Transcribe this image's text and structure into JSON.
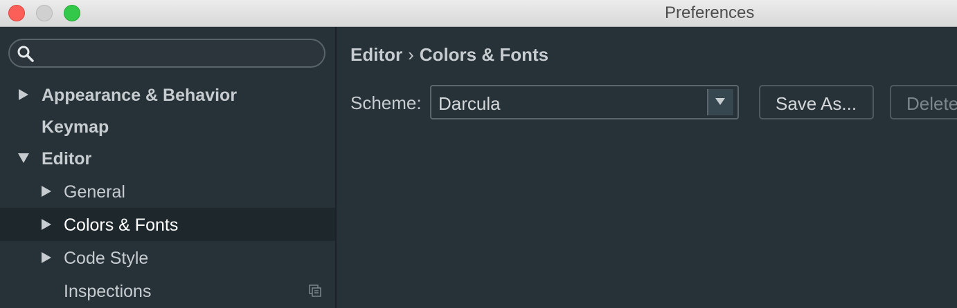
{
  "window": {
    "title": "Preferences"
  },
  "sidebar": {
    "search": {
      "value": "",
      "placeholder": ""
    },
    "items": [
      {
        "label": "Appearance & Behavior",
        "expanded": false
      },
      {
        "label": "Keymap"
      },
      {
        "label": "Editor",
        "expanded": true
      },
      {
        "label": "General",
        "expanded": false
      },
      {
        "label": "Colors & Fonts",
        "expanded": false,
        "selected": true
      },
      {
        "label": "Code Style",
        "expanded": false
      },
      {
        "label": "Inspections"
      }
    ]
  },
  "main": {
    "breadcrumb": {
      "parent": "Editor",
      "separator": "›",
      "current": "Colors & Fonts"
    },
    "scheme": {
      "label": "Scheme:",
      "selected": "Darcula"
    },
    "buttons": {
      "save_as": "Save As...",
      "delete": "Delete"
    }
  },
  "icons": {
    "search": "search-icon",
    "collapsed": "chevron-right-icon",
    "expanded": "chevron-down-icon",
    "project_scope": "copy-icon",
    "dropdown": "dropdown-arrow-icon"
  },
  "colors": {
    "background": "#263238",
    "selection": "#1e272c",
    "text": "#c7ccd0",
    "selected_text": "#ffffff",
    "close": "#fc5f57",
    "maximize": "#34c84a"
  }
}
